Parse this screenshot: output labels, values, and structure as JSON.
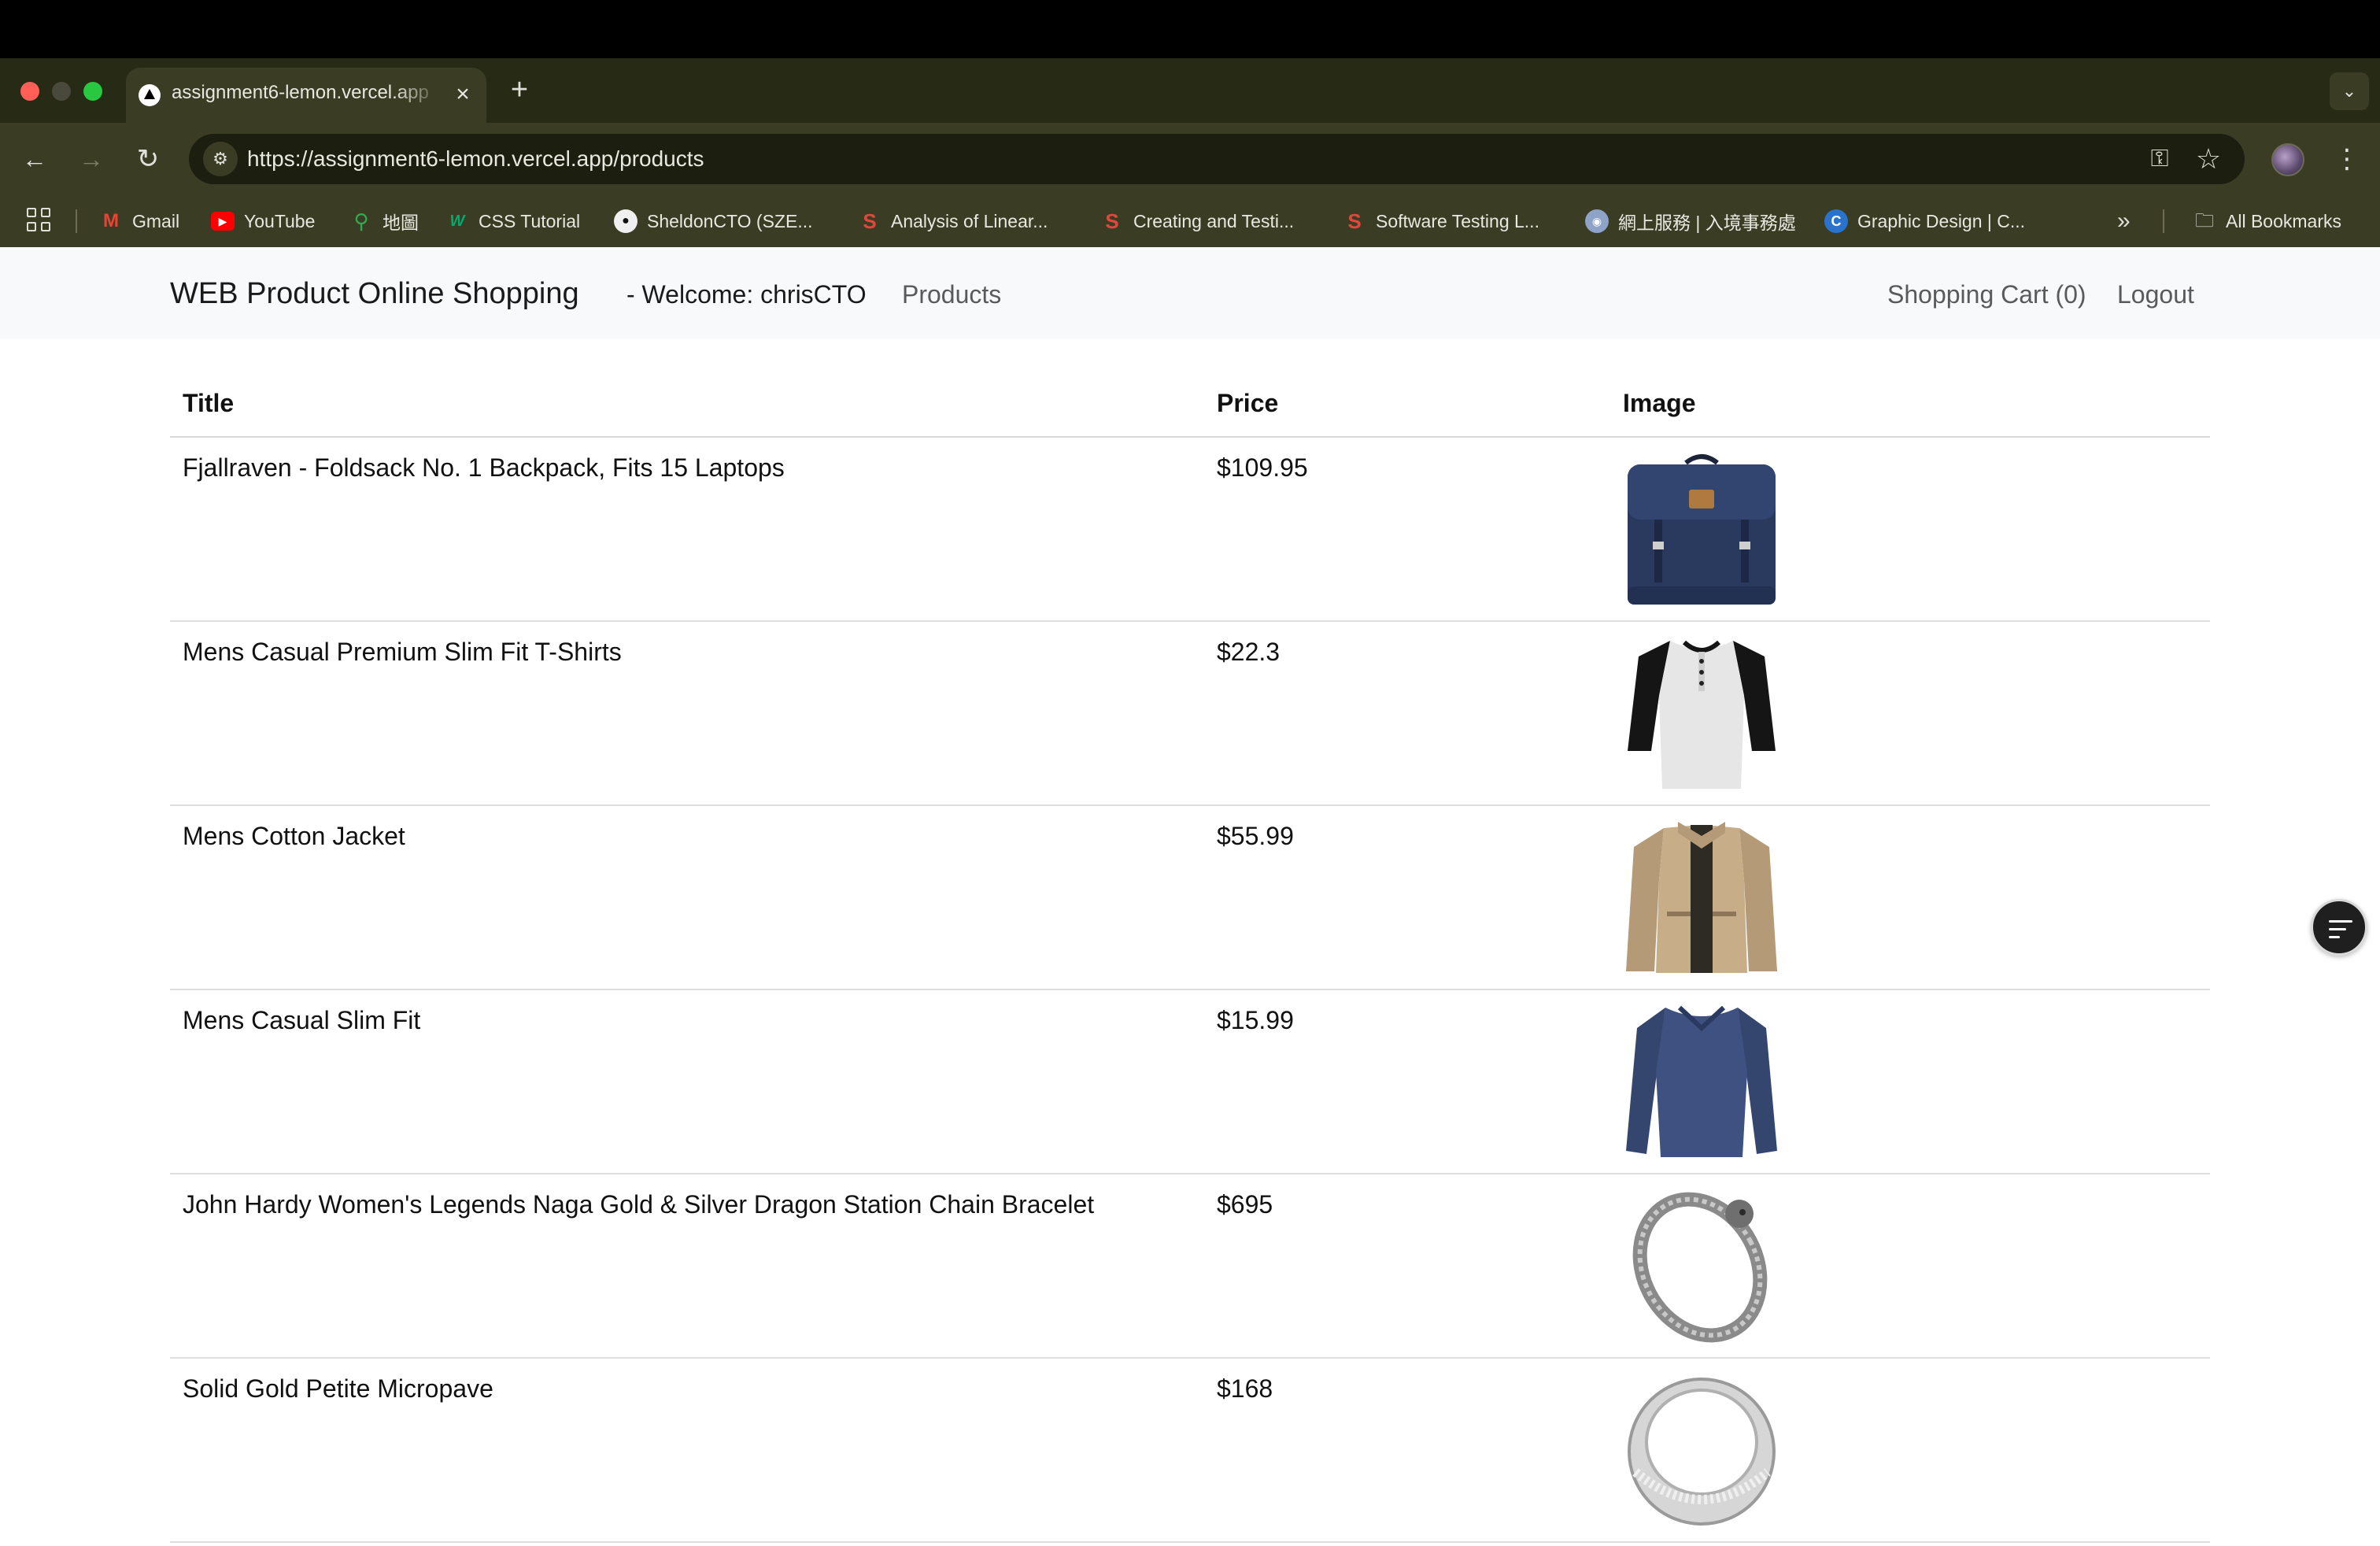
{
  "browser": {
    "tab": {
      "title": "assignment6-lemon.vercel.app"
    },
    "url": {
      "host": "https://assignment6-lemon.vercel.app",
      "path": "/products"
    },
    "bookmarks": [
      {
        "label": "Gmail",
        "icon": "gmail-icon"
      },
      {
        "label": "YouTube",
        "icon": "youtube-icon"
      },
      {
        "label": "地圖",
        "icon": "maps-icon"
      },
      {
        "label": "CSS Tutorial",
        "icon": "w3schools-icon"
      },
      {
        "label": "SheldonCTO (SZE...",
        "icon": "github-icon"
      },
      {
        "label": "Analysis of Linear...",
        "icon": "scribd-icon"
      },
      {
        "label": "Creating and Testi...",
        "icon": "scribd-icon"
      },
      {
        "label": "Software Testing L...",
        "icon": "scribd-icon"
      },
      {
        "label": "網上服務 | 入境事務處",
        "icon": "immd-icon"
      },
      {
        "label": "Graphic Design | C...",
        "icon": "coursera-icon"
      }
    ],
    "all_bookmarks": "All Bookmarks"
  },
  "navbar": {
    "brand": "WEB Product Online Shopping",
    "welcome": "- Welcome: chrisCTO",
    "products": "Products",
    "cart": "Shopping Cart (0)",
    "logout": "Logout"
  },
  "table": {
    "headers": {
      "title": "Title",
      "price": "Price",
      "image": "Image"
    },
    "rows": [
      {
        "title": "Fjallraven - Foldsack No. 1 Backpack, Fits 15 Laptops",
        "price": "$109.95",
        "image": "backpack"
      },
      {
        "title": "Mens Casual Premium Slim Fit T-Shirts",
        "price": "$22.3",
        "image": "raglan-shirt"
      },
      {
        "title": "Mens Cotton Jacket",
        "price": "$55.99",
        "image": "cotton-jacket"
      },
      {
        "title": "Mens Casual Slim Fit",
        "price": "$15.99",
        "image": "longsleeve-shirt"
      },
      {
        "title": "John Hardy Women's Legends Naga Gold & Silver Dragon Station Chain Bracelet",
        "price": "$695",
        "image": "dragon-bracelet"
      },
      {
        "title": "Solid Gold Petite Micropave",
        "price": "$168",
        "image": "silver-ring"
      }
    ]
  },
  "colors": {
    "chrome_dark": "#272a15",
    "chrome": "#3a3d24",
    "navbar_bg": "#f8f9fa"
  }
}
